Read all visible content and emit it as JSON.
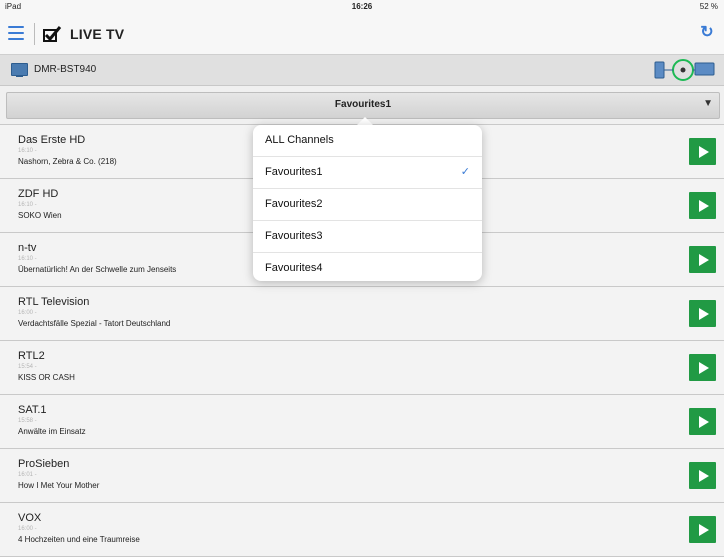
{
  "status": {
    "device": "iPad",
    "time": "16:26",
    "battery": "52 %"
  },
  "nav": {
    "title": "LIVE TV"
  },
  "device": {
    "name": "DMR-BST940"
  },
  "filter": {
    "selected": "Favourites1"
  },
  "dropdown": {
    "options": [
      {
        "label": "ALL Channels",
        "checked": false,
        "check": ""
      },
      {
        "label": "Favourites1",
        "checked": true,
        "check": "✓"
      },
      {
        "label": "Favourites2",
        "checked": false,
        "check": ""
      },
      {
        "label": "Favourites3",
        "checked": false,
        "check": ""
      },
      {
        "label": "Favourites4",
        "checked": false,
        "check": ""
      }
    ]
  },
  "channels": [
    {
      "name": "Das Erste HD",
      "time": "16:10 -",
      "program": "Nashorn, Zebra & Co. (218)"
    },
    {
      "name": "ZDF HD",
      "time": "16:10 -",
      "program": "SOKO Wien"
    },
    {
      "name": "n-tv",
      "time": "16:10 -",
      "program": "Übernatürlich! An der Schwelle zum Jenseits"
    },
    {
      "name": "RTL Television",
      "time": "16:00 -",
      "program": "Verdachtsfälle Spezial - Tatort Deutschland"
    },
    {
      "name": "RTL2",
      "time": "15:54 -",
      "program": "KISS OR CASH"
    },
    {
      "name": "SAT.1",
      "time": "15:58 -",
      "program": "Anwälte im Einsatz"
    },
    {
      "name": "ProSieben",
      "time": "16:01 -",
      "program": "How I Met Your Mother"
    },
    {
      "name": "VOX",
      "time": "16:00 -",
      "program": "4 Hochzeiten und eine Traumreise"
    }
  ],
  "colors": {
    "accent": "#3a7bd5",
    "play": "#219a44"
  },
  "icons": {
    "menu": "hamburger-icon",
    "logo": "checkbox-logo-icon",
    "refresh": "refresh-icon",
    "tv": "tv-icon",
    "stb": "set-top-box-icon",
    "play": "play-icon"
  }
}
